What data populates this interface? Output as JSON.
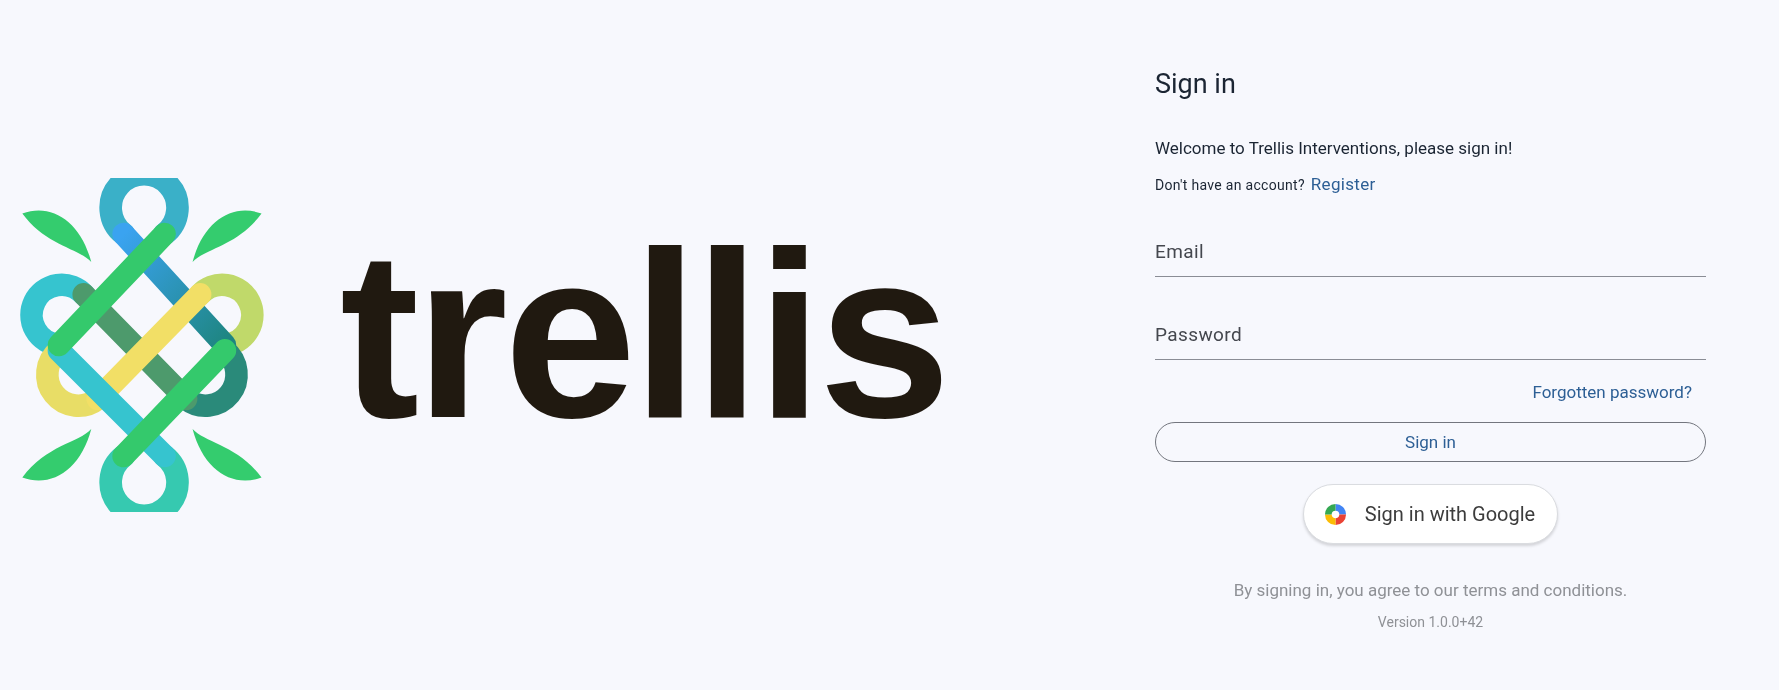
{
  "brand": {
    "wordmark": "trellis"
  },
  "form": {
    "title": "Sign in",
    "welcome": "Welcome to Trellis Interventions, please sign in!",
    "account_prompt": "Don't have an account?",
    "register_link": "Register",
    "fields": [
      {
        "placeholder": "Email"
      },
      {
        "placeholder": "Password"
      }
    ],
    "forgot_link": "Forgotten password?",
    "submit_button": "Sign in",
    "google_button": "Sign in with Google",
    "terms": "By signing in, you agree to our terms and conditions.",
    "version": "Version 1.0.0+42"
  }
}
